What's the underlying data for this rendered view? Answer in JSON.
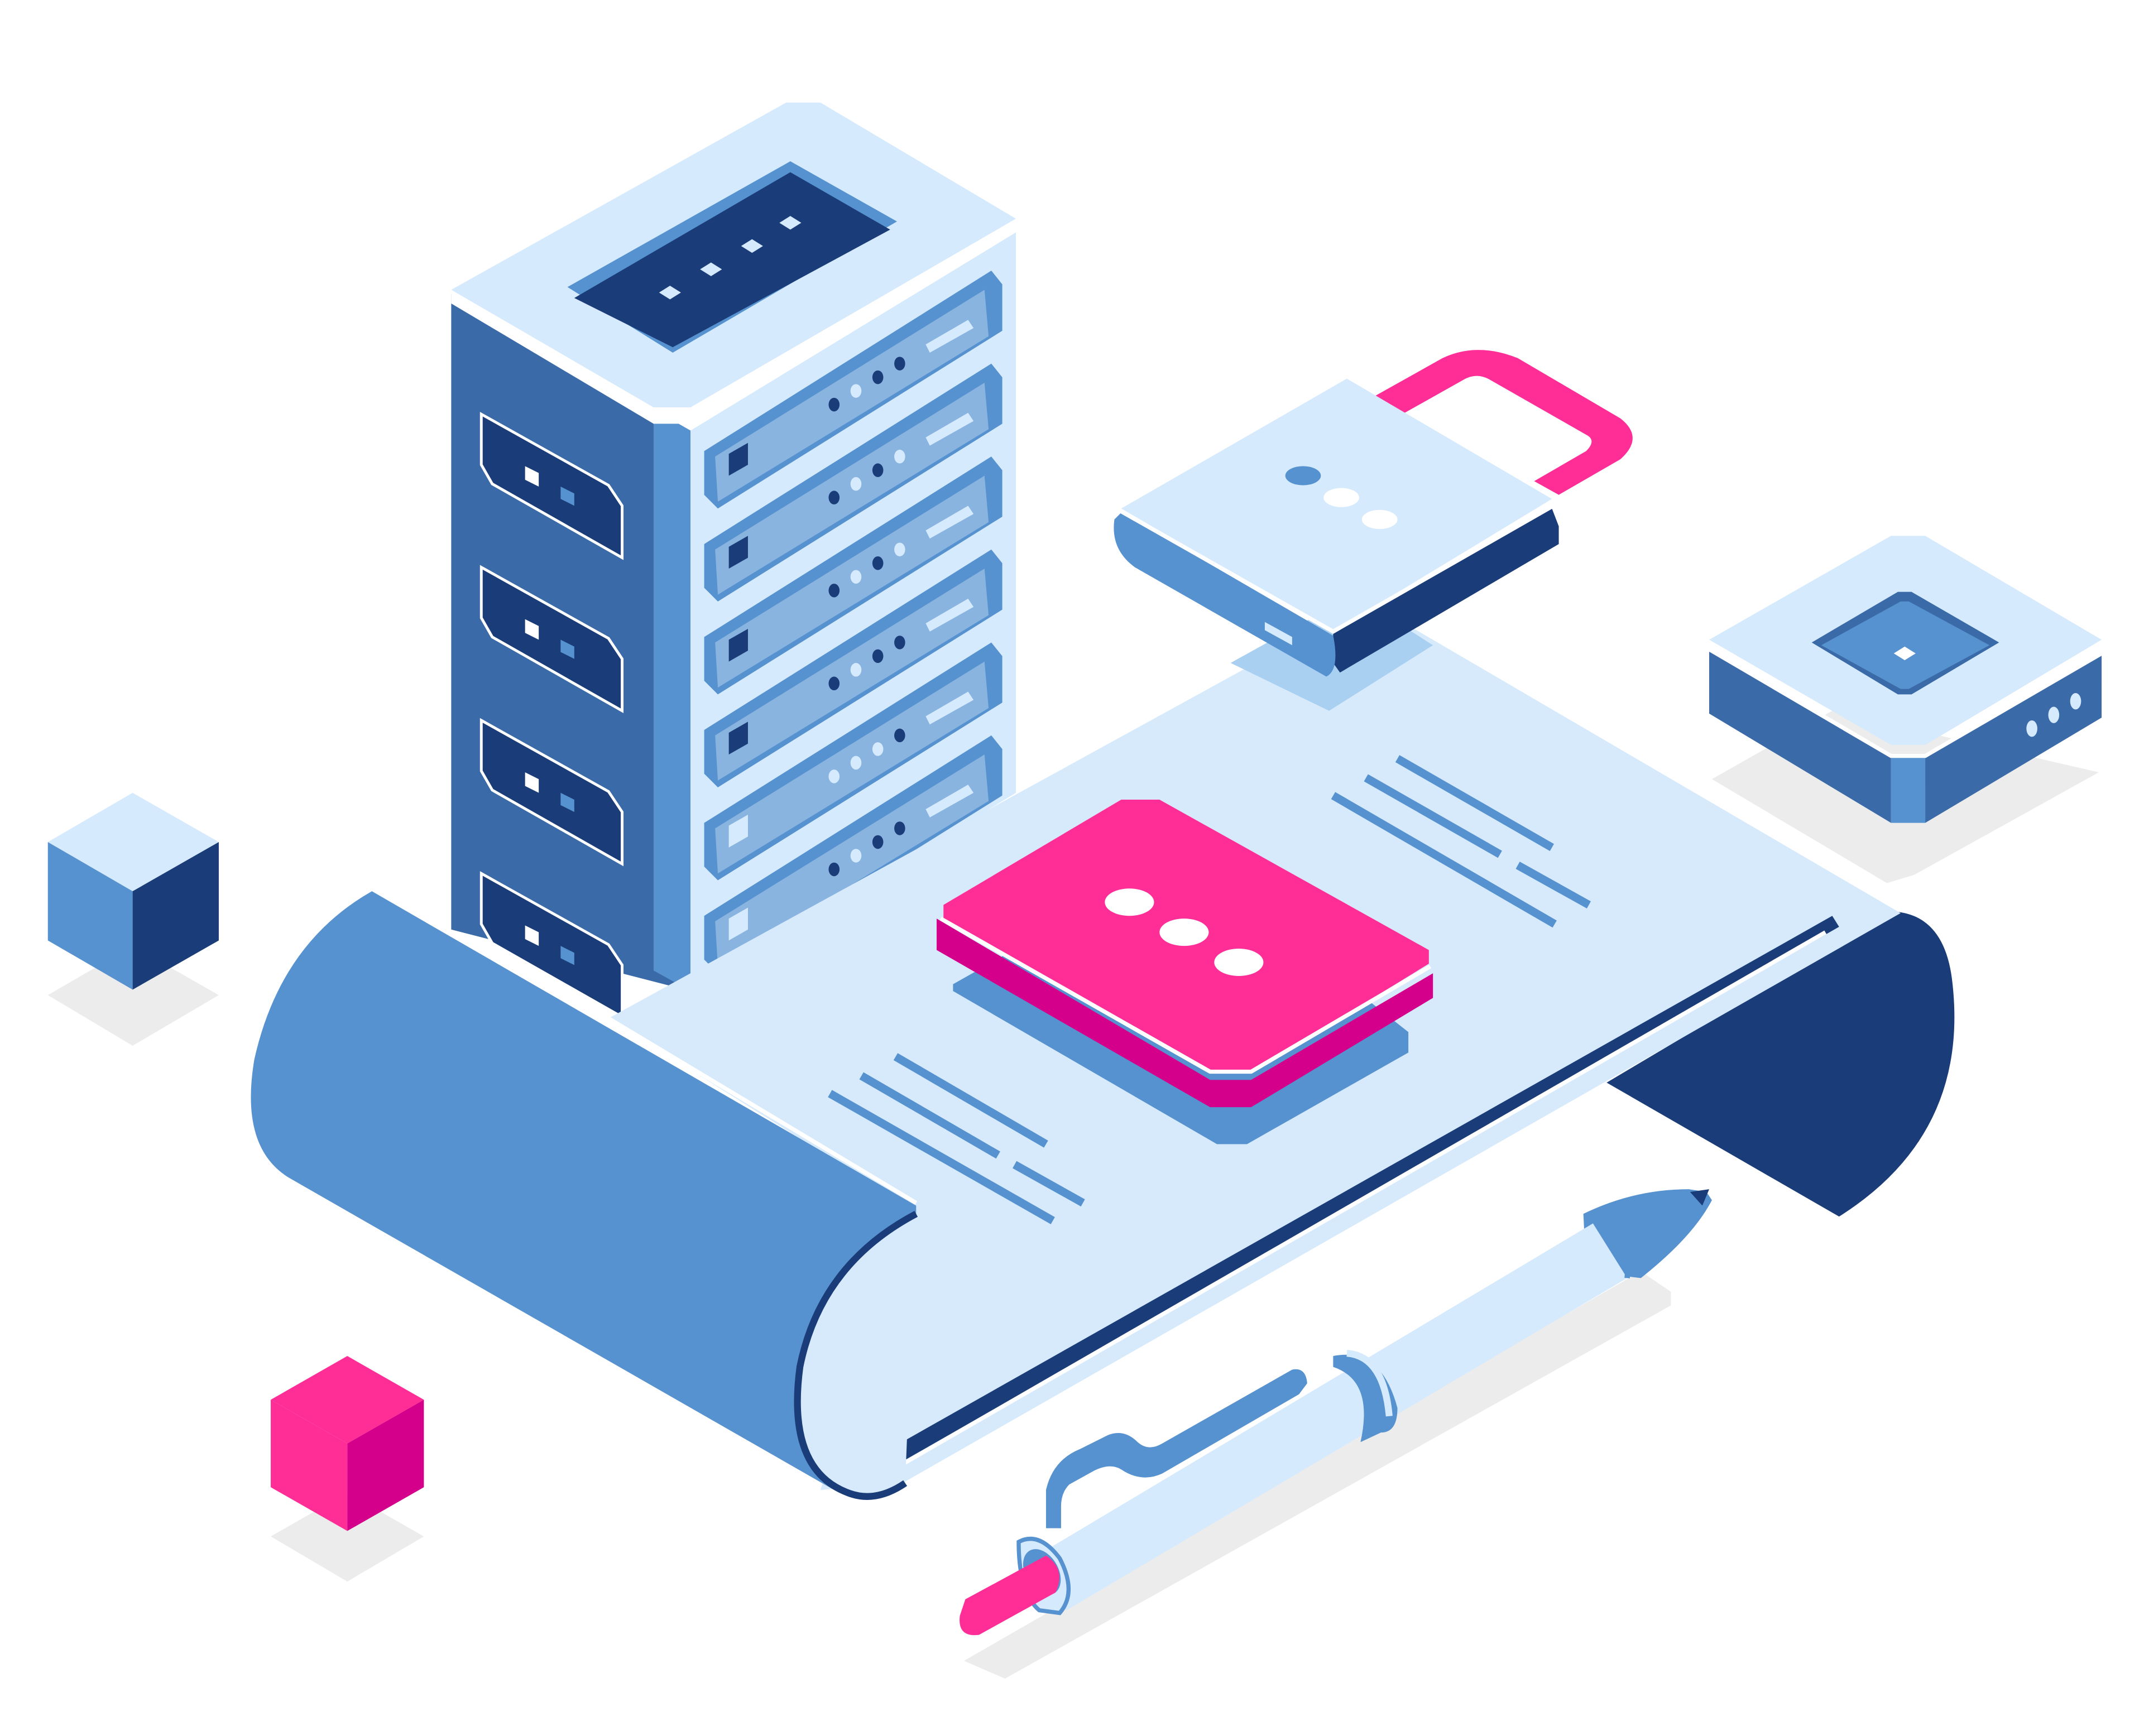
{
  "scene": {
    "objects": [
      "server-tower",
      "document-scroll",
      "padlock",
      "message-card",
      "network-box",
      "pen",
      "blue-cube",
      "pink-cube"
    ]
  },
  "colors": {
    "background": "#ffffff",
    "paper": "#d6eafc",
    "light": "#d5eafc",
    "mid_blue": "#5692cf",
    "steel_blue": "#3a6aa8",
    "navy": "#1a3c78",
    "pink": "#ff2d96",
    "magenta": "#d4008b",
    "shadow": "#ececec"
  }
}
